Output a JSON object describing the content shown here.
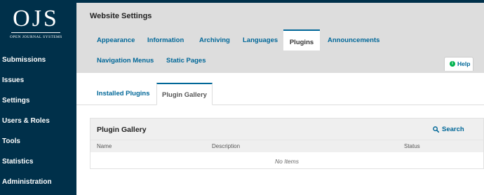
{
  "sidebar": {
    "logo": {
      "text": "OJS",
      "subtext": "OPEN JOURNAL SYSTEMS"
    },
    "items": [
      {
        "label": "Submissions"
      },
      {
        "label": "Issues"
      },
      {
        "label": "Settings"
      },
      {
        "label": "Users & Roles"
      },
      {
        "label": "Tools"
      },
      {
        "label": "Statistics"
      },
      {
        "label": "Administration"
      }
    ]
  },
  "header": {
    "title": "Website Settings",
    "tabs": [
      {
        "label": "Appearance"
      },
      {
        "label": "Information"
      },
      {
        "label": "Archiving"
      },
      {
        "label": "Languages"
      },
      {
        "label": "Plugins",
        "active": true
      },
      {
        "label": "Announcements"
      },
      {
        "label": "Navigation Menus"
      },
      {
        "label": "Static Pages"
      }
    ],
    "help_label": "Help"
  },
  "subtabs": [
    {
      "label": "Installed Plugins"
    },
    {
      "label": "Plugin Gallery",
      "active": true
    }
  ],
  "panel": {
    "title": "Plugin Gallery",
    "search_label": "Search",
    "columns": [
      "Name",
      "Description",
      "Status"
    ],
    "empty_text": "No Items"
  },
  "colors": {
    "sidebar_bg": "#00304a",
    "accent": "#006798",
    "header_bg": "#dddddd",
    "help_icon": "#00b24e"
  }
}
